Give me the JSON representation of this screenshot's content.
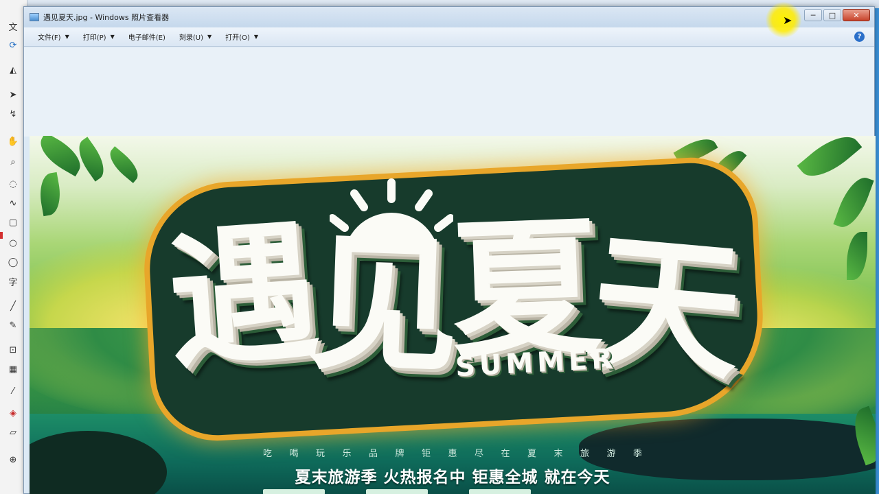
{
  "window": {
    "title": "遇见夏天.jpg - Windows 照片查看器",
    "buttons": {
      "minimize": "─",
      "maximize": "□",
      "close": "✕"
    }
  },
  "menu": [
    {
      "label": "文件(F)",
      "has_arrow": true
    },
    {
      "label": "打印(P)",
      "has_arrow": true
    },
    {
      "label": "电子邮件(E)",
      "has_arrow": false
    },
    {
      "label": "刻录(U)",
      "has_arrow": true
    },
    {
      "label": "打开(O)",
      "has_arrow": true
    }
  ],
  "help_label": "?",
  "banner": {
    "title_chars": [
      "遇",
      "见",
      "夏",
      "天"
    ],
    "title_en": "SUMMER",
    "tagline_small": [
      "吃",
      "喝",
      "玩",
      "乐",
      "品",
      "牌",
      "钜",
      "惠",
      "尽",
      "在",
      "夏",
      "末",
      "旅",
      "游",
      "季"
    ],
    "tagline_big": "夏末旅游季 火热报名中 钜惠全城 就在今天"
  },
  "colors": {
    "title_bar": "#c5d8ec",
    "menu_bar": "#dae6f3",
    "view_bg": "#e9f1f8",
    "close_button": "#c8432b",
    "title_outline": "#e8a62a",
    "cursor_highlight": "#fff200"
  }
}
